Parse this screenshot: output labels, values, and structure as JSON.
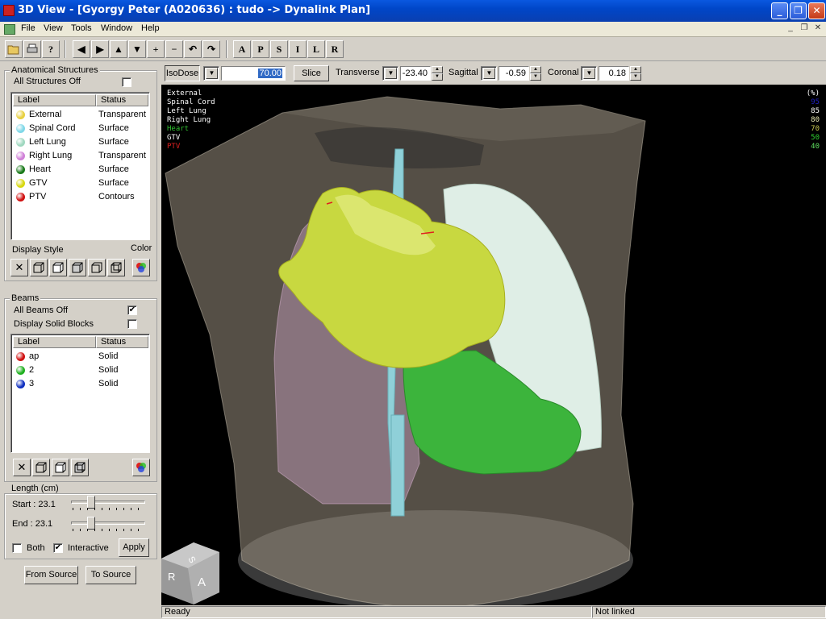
{
  "window": {
    "title": "3D View - [Gyorgy Peter (A020636) : tudo -> Dynalink Plan]"
  },
  "menu": [
    "File",
    "View",
    "Tools",
    "Window",
    "Help"
  ],
  "toolbar": {
    "view_buttons": [
      "A",
      "P",
      "S",
      "I",
      "L",
      "R"
    ]
  },
  "anatomical": {
    "title": "Anatomical Structures",
    "all_off_label": "All Structures Off",
    "all_off_checked": false,
    "columns": [
      "Label",
      "Status"
    ],
    "rows": [
      {
        "label": "External",
        "status": "Transparent",
        "color": "#e8d040"
      },
      {
        "label": "Spinal Cord",
        "status": "Surface",
        "color": "#80d8e8"
      },
      {
        "label": "Left Lung",
        "status": "Surface",
        "color": "#a0d8c0"
      },
      {
        "label": "Right Lung",
        "status": "Transparent",
        "color": "#d080d8"
      },
      {
        "label": "Heart",
        "status": "Surface",
        "color": "#1a7a1a"
      },
      {
        "label": "GTV",
        "status": "Surface",
        "color": "#d8d810"
      },
      {
        "label": "PTV",
        "status": "Contours",
        "color": "#d01010"
      }
    ],
    "display_style_label": "Display Style",
    "color_label": "Color"
  },
  "beams": {
    "title": "Beams",
    "all_off_label": "All Beams Off",
    "all_off_checked": true,
    "solid_blocks_label": "Display Solid Blocks",
    "solid_blocks_checked": false,
    "columns": [
      "Label",
      "Status"
    ],
    "rows": [
      {
        "label": "ap",
        "status": "Solid",
        "color": "#d01010"
      },
      {
        "label": "2",
        "status": "Solid",
        "color": "#20b020"
      },
      {
        "label": "3",
        "status": "Solid",
        "color": "#1030c0"
      }
    ]
  },
  "length": {
    "title": "Length (cm)",
    "start_label": "Start : 23.1",
    "end_label": "End : 23.1",
    "both_label": "Both",
    "both_checked": false,
    "interactive_label": "Interactive",
    "interactive_checked": true,
    "apply_label": "Apply"
  },
  "buttons": {
    "from_source": "From Source",
    "to_source": "To Source"
  },
  "slice_controls": {
    "isodose_label": "IsoDose",
    "isodose_value": "70.00",
    "slice_label": "Slice",
    "transverse_label": "Transverse",
    "transverse_value": "-23.40",
    "sagittal_label": "Sagittal",
    "sagittal_value": "-0.59",
    "coronal_label": "Coronal",
    "coronal_value": "0.18"
  },
  "viewport": {
    "legend": [
      {
        "label": "External",
        "color": "#ffffff"
      },
      {
        "label": "Spinal Cord",
        "color": "#ffffff"
      },
      {
        "label": "Left Lung",
        "color": "#ffffff"
      },
      {
        "label": "Right Lung",
        "color": "#ffffff"
      },
      {
        "label": "Heart",
        "color": "#30c030"
      },
      {
        "label": "GTV",
        "color": "#ffffff"
      },
      {
        "label": "PTV",
        "color": "#e02020"
      }
    ],
    "isodose_header": "(%)",
    "isodose_levels": [
      {
        "value": "95",
        "color": "#2020c0"
      },
      {
        "value": "85",
        "color": "#ffffff"
      },
      {
        "value": "80",
        "color": "#e8e8b0"
      },
      {
        "value": "70",
        "color": "#c8c850"
      },
      {
        "value": "50",
        "color": "#30d030"
      },
      {
        "value": "40",
        "color": "#60e060"
      }
    ],
    "orientation_cube": [
      "S",
      "R",
      "A"
    ]
  },
  "status": {
    "left": "Ready",
    "right": "Not linked"
  }
}
